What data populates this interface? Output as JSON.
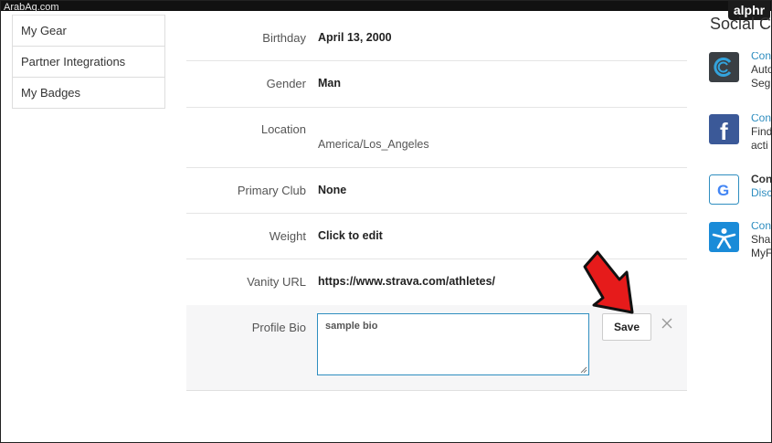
{
  "watermark": "ArabAq.com",
  "brand_badge": "alphr",
  "sidebar": {
    "items": [
      {
        "label": "My Gear"
      },
      {
        "label": "Partner Integrations"
      },
      {
        "label": "My Badges"
      }
    ]
  },
  "profile": {
    "rows": [
      {
        "label": "Birthday",
        "value": "April 13, 2000"
      },
      {
        "label": "Gender",
        "value": "Man"
      },
      {
        "label": "Location",
        "value": "America/Los_Angeles"
      },
      {
        "label": "Primary Club",
        "value": "None"
      },
      {
        "label": "Weight",
        "value": "Click to edit"
      },
      {
        "label": "Vanity URL",
        "value": "https://www.strava.com/athletes/"
      }
    ],
    "bio": {
      "label": "Profile Bio",
      "value": "sample bio",
      "save_label": "Save"
    }
  },
  "social": {
    "title": "Social C",
    "items": [
      {
        "icon": "connect-app-icon",
        "line1": "Con",
        "line2": "Auto",
        "line3": "Seg"
      },
      {
        "icon": "facebook-icon",
        "line1": "Con",
        "line2": "Find",
        "line3": "acti"
      },
      {
        "icon": "google-icon",
        "line1": "Con",
        "line2": "Disc"
      },
      {
        "icon": "myfitnesspal-icon",
        "line1": "Con",
        "line2": "Sha",
        "line3": "MyF"
      }
    ]
  },
  "colors": {
    "accent_link": "#2f8ec0",
    "arrow": "#e61b1b",
    "bio_background": "#f6f6f7"
  }
}
